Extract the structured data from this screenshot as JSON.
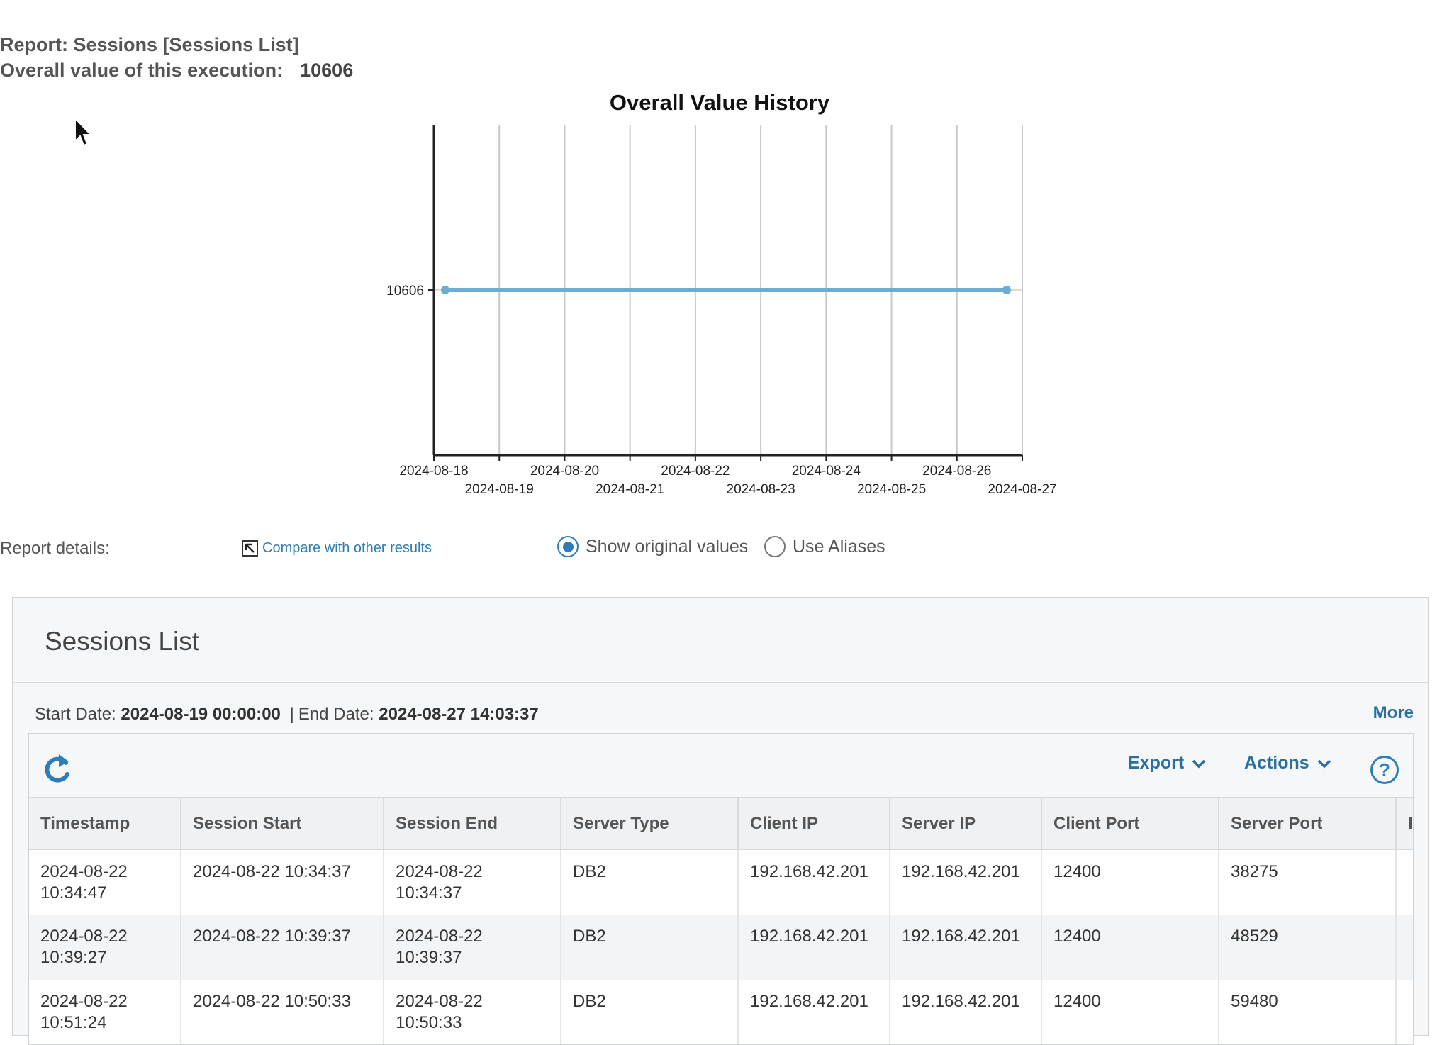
{
  "report": {
    "title": "Report: Sessions [Sessions List]",
    "overall_label": "Overall value of this execution:",
    "overall_value": "10606"
  },
  "chart_data": {
    "type": "line",
    "title": "Overall Value History",
    "xlabel": "",
    "ylabel": "",
    "x_ticks": [
      "2024-08-18",
      "2024-08-19",
      "2024-08-20",
      "2024-08-21",
      "2024-08-22",
      "2024-08-23",
      "2024-08-24",
      "2024-08-25",
      "2024-08-26",
      "2024-08-27"
    ],
    "y_ticks": [
      "10606"
    ],
    "series": [
      {
        "x": [
          "2024-08-18",
          "2024-08-27"
        ],
        "values": [
          10606,
          10606
        ],
        "color": "#6aaed6"
      }
    ],
    "grid": "vertical"
  },
  "details": {
    "label": "Report details:",
    "compare_link": "Compare with other results",
    "radio_original": "Show original values",
    "radio_aliases": "Use Aliases",
    "selected": "original"
  },
  "panel": {
    "title": "Sessions List",
    "start_label": "Start Date:",
    "start_value": "2024-08-19 00:00:00",
    "end_label": "End Date:",
    "end_value": "2024-08-27 14:03:37",
    "more": "More"
  },
  "toolbar": {
    "refresh_icon": "refresh-icon",
    "export": "Export",
    "actions": "Actions",
    "help": "?"
  },
  "table": {
    "columns": [
      "Timestamp",
      "Session Start",
      "Session End",
      "Server Type",
      "Client IP",
      "Server IP",
      "Client Port",
      "Server Port",
      "I"
    ],
    "rows": [
      [
        "2024-08-22 10:34:47",
        "2024-08-22 10:34:37",
        "2024-08-22 10:34:37",
        "DB2",
        "192.168.42.201",
        "192.168.42.201",
        "12400",
        "38275",
        ""
      ],
      [
        "2024-08-22 10:39:27",
        "2024-08-22 10:39:37",
        "2024-08-22 10:39:37",
        "DB2",
        "192.168.42.201",
        "192.168.42.201",
        "12400",
        "48529",
        ""
      ],
      [
        "2024-08-22 10:51:24",
        "2024-08-22 10:50:33",
        "2024-08-22 10:50:33",
        "DB2",
        "192.168.42.201",
        "192.168.42.201",
        "12400",
        "59480",
        ""
      ]
    ]
  },
  "colors": {
    "accent": "#2f7db6",
    "line": "#6aaed6"
  }
}
